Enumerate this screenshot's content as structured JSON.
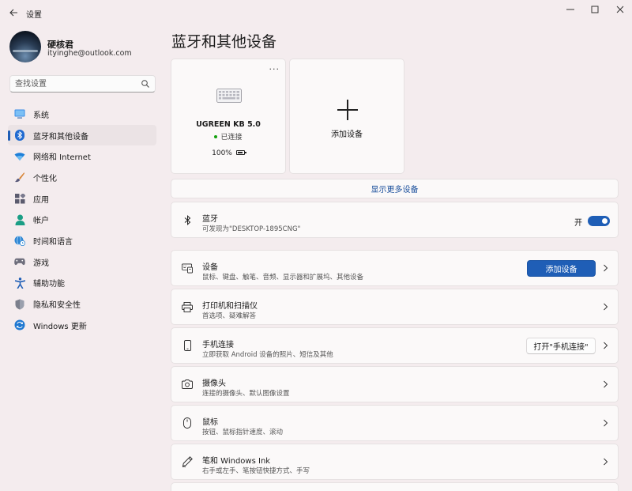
{
  "app": {
    "title": "设置"
  },
  "profile": {
    "name": "硬核君",
    "email": "ityinghe@outlook.com"
  },
  "search": {
    "placeholder": "查找设置"
  },
  "sidebar": {
    "items": [
      {
        "label": "系统",
        "icon": "monitor-icon",
        "selected": false
      },
      {
        "label": "蓝牙和其他设备",
        "icon": "bluetooth-icon",
        "selected": true
      },
      {
        "label": "网络和 Internet",
        "icon": "wifi-icon",
        "selected": false
      },
      {
        "label": "个性化",
        "icon": "brush-icon",
        "selected": false
      },
      {
        "label": "应用",
        "icon": "apps-icon",
        "selected": false
      },
      {
        "label": "帐户",
        "icon": "account-icon",
        "selected": false
      },
      {
        "label": "时间和语言",
        "icon": "globe-clock-icon",
        "selected": false
      },
      {
        "label": "游戏",
        "icon": "gamepad-icon",
        "selected": false
      },
      {
        "label": "辅助功能",
        "icon": "accessibility-icon",
        "selected": false
      },
      {
        "label": "隐私和安全性",
        "icon": "shield-icon",
        "selected": false
      },
      {
        "label": "Windows 更新",
        "icon": "update-icon",
        "selected": false
      }
    ]
  },
  "main": {
    "title": "蓝牙和其他设备",
    "device_card": {
      "name": "UGREEN KB 5.0",
      "status": "已连接",
      "battery": "100%",
      "more": "···"
    },
    "add_card": {
      "label": "添加设备"
    },
    "show_more": "显示更多设备",
    "bluetooth": {
      "title": "蓝牙",
      "subtitle": "可发现为\"DESKTOP-1895CNG\"",
      "toggle_label": "开"
    },
    "devices": {
      "title": "设备",
      "subtitle": "鼠标、键盘、触笔、音频、显示器和扩展坞、其他设备",
      "button": "添加设备"
    },
    "printers": {
      "title": "打印机和扫描仪",
      "subtitle": "首选项、疑难解答"
    },
    "phone": {
      "title": "手机连接",
      "subtitle": "立即获取 Android 设备的照片、短信及其他",
      "button": "打开\"手机连接\""
    },
    "camera": {
      "title": "摄像头",
      "subtitle": "连接的摄像头、默认图像设置"
    },
    "mouse": {
      "title": "鼠标",
      "subtitle": "按钮、鼠标指针速度、滚动"
    },
    "pen": {
      "title": "笔和 Windows Ink",
      "subtitle": "右手或左手、笔按钮快捷方式、手写"
    }
  },
  "colors": {
    "accent": "#1f5eb6",
    "background": "#f4ecee",
    "card": "#fbf9f9",
    "link": "#1a4f9c",
    "connected": "#13a10e"
  }
}
